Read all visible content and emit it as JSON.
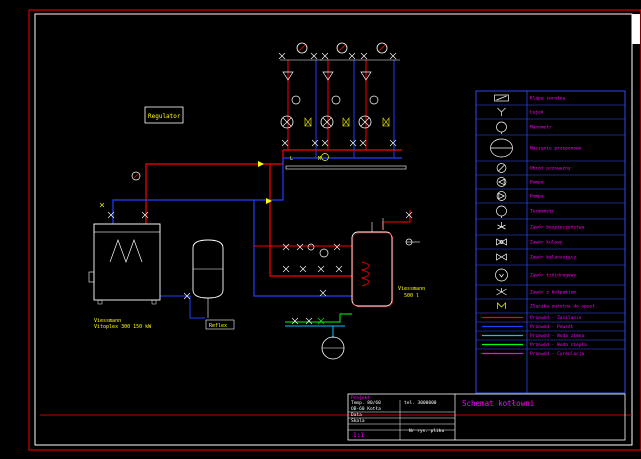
{
  "regulator": {
    "label": "Regulator"
  },
  "boiler": {
    "brand": "Viessmann",
    "model": "Vitoplex  300 150 kW"
  },
  "expansion_vessel": {
    "label": "Reflex"
  },
  "storage_tank": {
    "brand": "Viessmann",
    "volume": "500 l"
  },
  "legend": {
    "items": [
      {
        "icon": "air-vent",
        "label": "Klapa zwrotna"
      },
      {
        "icon": "funnel",
        "label": "Lejek"
      },
      {
        "icon": "manometer",
        "label": "Manometr"
      },
      {
        "icon": "expansion-vessel",
        "label": "Naczynie przeponowe"
      },
      {
        "icon": "flow-meter",
        "label": "Obrót przeważny"
      },
      {
        "icon": "pump",
        "label": "Pompa"
      },
      {
        "icon": "pump-alt",
        "label": "Pompa"
      },
      {
        "icon": "thermometer",
        "label": "Termometr"
      },
      {
        "icon": "safety-valve",
        "label": "Zawór bezpieczeństwa"
      },
      {
        "icon": "ball-valve",
        "label": "Zawór kulowy"
      },
      {
        "icon": "balancing-valve",
        "label": "Zawór balansujący"
      },
      {
        "icon": "three-way-valve",
        "label": "Zawór trójdrogowy"
      },
      {
        "icon": "drain-valve",
        "label": "Zawór z kołpakiem"
      },
      {
        "icon": "check-valve",
        "label": "Złączka zwrotna do spust."
      }
    ],
    "lines": [
      {
        "color": "#ff0000",
        "label": "Przewód - Zasilanie"
      },
      {
        "color": "#2040ff",
        "label": "Przewód - Powrót"
      },
      {
        "color": "#00c8ff",
        "label": "Przewód - Woda zimna"
      },
      {
        "color": "#00ff00",
        "label": "Przewód - Woda ciepła"
      },
      {
        "color": "#ff00ff",
        "label": "Przewód - Cyrkulacja"
      }
    ]
  },
  "title_block": {
    "title": "Schemat kotłowni",
    "row1_left": "Projekt",
    "row2_left": "Temp. 80/60",
    "row2_mid": "tel. 3000000",
    "row3_left": "OB-60 Kotła",
    "row4_left": "Data",
    "row5_left": "Skala",
    "scale": "1:1",
    "sheet": "Nr rys. pliku"
  },
  "colors": {
    "frame_red": "#ff0000",
    "frame_white": "#ffffff",
    "legend_border": "#3050ff",
    "symbols": "#ffffff",
    "labels": "#ffff00",
    "text_magenta": "#ff00ff"
  }
}
